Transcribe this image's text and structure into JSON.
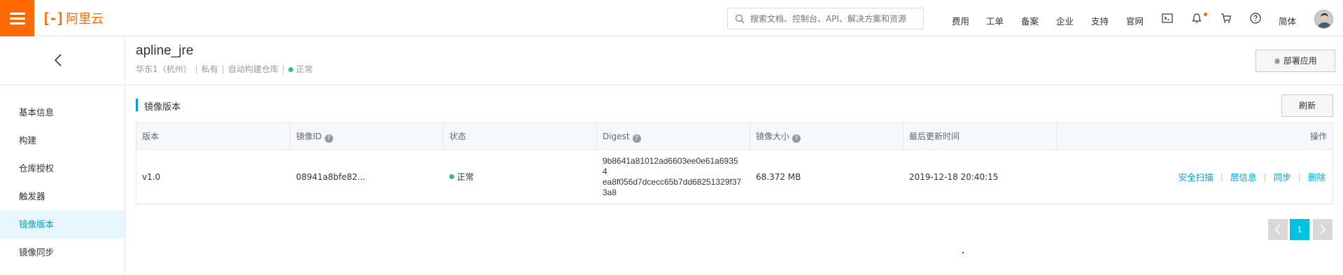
{
  "topbar": {
    "logo_mark": "[-]",
    "logo_text": "阿里云",
    "search_placeholder": "搜索文档、控制台、API、解决方案和资源",
    "links": [
      "费用",
      "工单",
      "备案",
      "企业",
      "支持",
      "官网"
    ],
    "lang": "简体",
    "icons": [
      "terminal-icon",
      "bell-icon",
      "cart-icon",
      "help-icon"
    ],
    "accent": "#ff6a00"
  },
  "sidebar": {
    "items": [
      {
        "label": "基本信息"
      },
      {
        "label": "构建"
      },
      {
        "label": "仓库授权"
      },
      {
        "label": "触发器"
      },
      {
        "label": "镜像版本",
        "active": true
      },
      {
        "label": "镜像同步"
      }
    ]
  },
  "header": {
    "title": "apline_jre",
    "region": "华东1（杭州）",
    "visibility": "私有",
    "build_type": "自动构建仓库",
    "status": "正常",
    "deploy_label": "部署应用"
  },
  "section": {
    "title": "镜像版本",
    "refresh_label": "刷新"
  },
  "table": {
    "columns": [
      "版本",
      "镜像ID",
      "状态",
      "Digest",
      "镜像大小",
      "最后更新时间",
      "操作"
    ],
    "rows": [
      {
        "version": "v1.0",
        "image_id": "08941a8bfe82...",
        "status": "正常",
        "digest": "9b8641a81012ad6603ee0e61a69354\nea8f056d7dcecc65b7dd68251329f37\n3a8",
        "size": "68.372 MB",
        "updated": "2019-12-18 20:40:15",
        "actions": [
          "安全扫描",
          "层信息",
          "同步",
          "删除"
        ]
      }
    ]
  },
  "pagination": {
    "current": "1",
    "prev": "‹",
    "next": "›"
  },
  "colors": {
    "link": "#00a2ca",
    "status_ok": "#3dbd7d",
    "active_bg": "#e6f7fd",
    "page_active": "#00c1de"
  }
}
